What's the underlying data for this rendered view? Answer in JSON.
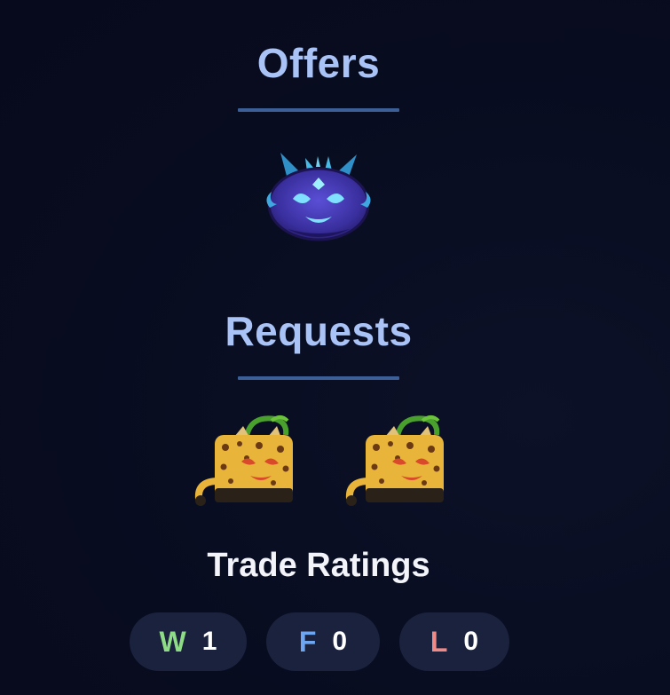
{
  "offers": {
    "title": "Offers",
    "items": [
      {
        "icon": "shadow-fruit-icon"
      }
    ]
  },
  "requests": {
    "title": "Requests",
    "items": [
      {
        "icon": "leopard-fruit-icon"
      },
      {
        "icon": "leopard-fruit-icon"
      }
    ]
  },
  "ratings": {
    "title": "Trade Ratings",
    "win": {
      "letter": "W",
      "count": "1",
      "color": "#8fdc86"
    },
    "fair": {
      "letter": "F",
      "count": "0",
      "color": "#6fa6f2"
    },
    "loss": {
      "letter": "L",
      "count": "0",
      "color": "#f08a86"
    }
  },
  "colors": {
    "background": "#090d22",
    "heading": "#a9c3f6",
    "divider": "#3b5f96",
    "pill": "#1a223d"
  }
}
